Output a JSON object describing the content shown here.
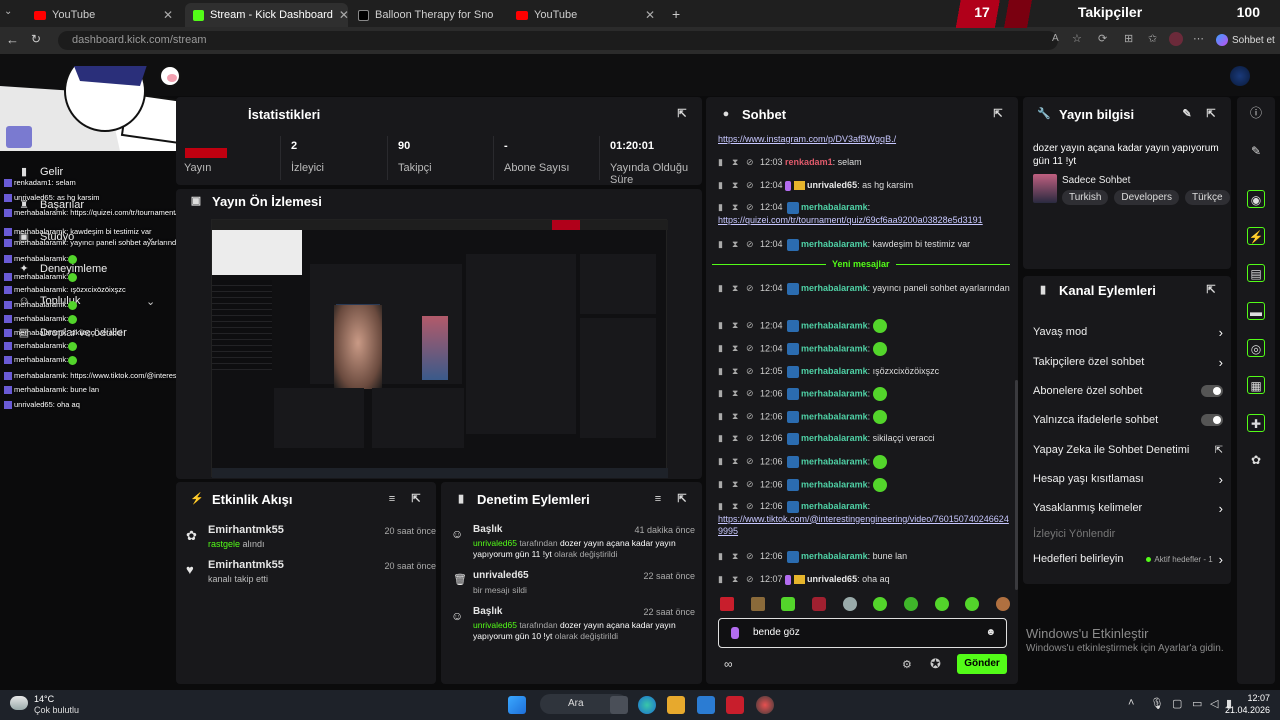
{
  "browser": {
    "tabs": [
      {
        "label": "YouTube",
        "icon": "youtube-icon"
      },
      {
        "label": "Stream - Kick Dashboard",
        "icon": "kick-icon"
      },
      {
        "label": "Balloon Therapy for Snoring & Bre",
        "icon": "tiktok-icon"
      },
      {
        "label": "YouTube",
        "icon": "youtube-icon"
      }
    ],
    "address": "dashboard.kick.com/stream",
    "profile_button": "Sohbet et"
  },
  "overlay": {
    "follower_count": "17",
    "follower_title": "Takipçiler",
    "follower_total": "100",
    "chat_lines": [
      "renkadam1: selam",
      "unrivaled65: as hg karsim",
      "merhabalaramk: https://quizei.com/tr/tournament/quiz/69cf6aa9200a03828e5d3191",
      "merhabalaramk: kawdeşim bi testimiz var",
      "merhabalaramk: yayıncı paneli sohbet ayarlarından",
      "merhabalaramk:",
      "merhabalaramk:",
      "merhabalaramk: ışözxcixözöixşzc",
      "merhabalaramk:",
      "merhabalaramk:",
      "merhabalaramk: sikilaççi veracci",
      "merhabalaramk:",
      "merhabalaramk:",
      "merhabalaramk: https://www.tiktok.com/@interestingengineering/video/7601507402466249995",
      "merhabalaramk: bune lan",
      "unrivaled65: oha aq"
    ]
  },
  "sidebar": {
    "items": [
      {
        "label": "Gelir",
        "icon": "revenue-icon"
      },
      {
        "label": "Başarılar",
        "icon": "trophy-icon"
      },
      {
        "label": "Stüdyo",
        "icon": "studio-icon"
      },
      {
        "label": "Deneyimleme",
        "icon": "experience-icon"
      },
      {
        "label": "Topluluk",
        "icon": "community-icon"
      },
      {
        "label": "Droplar ve ödüller",
        "icon": "drops-icon"
      }
    ]
  },
  "stats": {
    "title": "İstatistikleri",
    "items": [
      {
        "value": "",
        "label": "Yayın"
      },
      {
        "value": "2",
        "label": "İzleyici"
      },
      {
        "value": "90",
        "label": "Takipçi"
      },
      {
        "value": "-",
        "label": "Abone Sayısı"
      },
      {
        "value": "01:20:01",
        "label": "Yayında Olduğu Süre"
      }
    ]
  },
  "preview": {
    "title": "Yayın Ön İzlemesi"
  },
  "activity": {
    "title": "Etkinlik Akışı",
    "items": [
      {
        "user": "Emirhantmk55",
        "action_prefix": "",
        "action": "rastgele",
        "action_suffix": " alındı",
        "time": "20 saat önce"
      },
      {
        "user": "Emirhantmk55",
        "action_prefix": "",
        "action": "",
        "action_suffix": "kanalı takip etti",
        "time": "20 saat önce"
      }
    ]
  },
  "moderation": {
    "title": "Denetim Eylemleri",
    "items": [
      {
        "heading": "Başlık",
        "time": "41 dakika önce",
        "user": "unrivaled65",
        "text1": " tarafından ",
        "value": "dozer yayın açana kadar yayın yapıyorum gün 11 !yt",
        "text2": " olarak değiştirildi"
      },
      {
        "heading": "unrivaled65",
        "time": "22 saat önce",
        "user": "",
        "text1": "bir mesajı sildi",
        "value": "",
        "text2": ""
      },
      {
        "heading": "Başlık",
        "time": "22 saat önce",
        "user": "unrivaled65",
        "text1": " tarafından ",
        "value": "dozer yayın açana kadar yayın yapıyorum gün 10 !yt",
        "text2": " olarak değiştirildi"
      }
    ]
  },
  "chat": {
    "title": "Sohbet",
    "top_link": "https://www.instagram.com/p/DV3afBWgqB./",
    "new_messages": "Yeni mesajlar",
    "messages": [
      {
        "time": "12:03",
        "user": "renkadam1",
        "color": "#e05a6b",
        "text": "selam",
        "kind": "text"
      },
      {
        "time": "12:04",
        "user": "unrivaled65",
        "color": "#e8e8e8",
        "text": "as hg karsim",
        "kind": "text"
      },
      {
        "time": "12:04",
        "user": "merhabalaramk",
        "color": "#4fd0a5",
        "text": "https://quizei.com/tr/tournament/quiz/69cf6aa9200a03828e5d3191",
        "kind": "link"
      },
      {
        "time": "12:04",
        "user": "merhabalaramk",
        "color": "#4fd0a5",
        "text": "kawdeşim bi testimiz var",
        "kind": "text"
      },
      {
        "time": "12:04",
        "user": "merhabalaramk",
        "color": "#4fd0a5",
        "text": "yayıncı paneli sohbet ayarlarından",
        "kind": "text"
      },
      {
        "time": "12:04",
        "user": "merhabalaramk",
        "color": "#4fd0a5",
        "text": "",
        "kind": "emote"
      },
      {
        "time": "12:04",
        "user": "merhabalaramk",
        "color": "#4fd0a5",
        "text": "",
        "kind": "emote"
      },
      {
        "time": "12:05",
        "user": "merhabalaramk",
        "color": "#4fd0a5",
        "text": "ışözxcixözöixşzc",
        "kind": "text"
      },
      {
        "time": "12:06",
        "user": "merhabalaramk",
        "color": "#4fd0a5",
        "text": "",
        "kind": "emote"
      },
      {
        "time": "12:06",
        "user": "merhabalaramk",
        "color": "#4fd0a5",
        "text": "",
        "kind": "emote"
      },
      {
        "time": "12:06",
        "user": "merhabalaramk",
        "color": "#4fd0a5",
        "text": "sikilaççi veracci",
        "kind": "text"
      },
      {
        "time": "12:06",
        "user": "merhabalaramk",
        "color": "#4fd0a5",
        "text": "",
        "kind": "emote"
      },
      {
        "time": "12:06",
        "user": "merhabalaramk",
        "color": "#4fd0a5",
        "text": "",
        "kind": "emote"
      },
      {
        "time": "12:06",
        "user": "merhabalaramk",
        "color": "#4fd0a5",
        "text": "https://www.tiktok.com/@interestingengineering/video/7601507402466249995",
        "kind": "link"
      },
      {
        "time": "12:06",
        "user": "merhabalaramk",
        "color": "#4fd0a5",
        "text": "bune lan",
        "kind": "text"
      },
      {
        "time": "12:07",
        "user": "unrivaled65",
        "color": "#e8e8e8",
        "text": "oha aq",
        "kind": "text"
      }
    ],
    "input_value": "bende göz",
    "send_label": "Gönder"
  },
  "stream_info": {
    "title": "Yayın bilgisi",
    "stream_title": "dozer yayın açana kadar yayın yapıyorum gün 11 !yt",
    "category": "Sadece Sohbet",
    "tags": [
      "Turkish",
      "Developers",
      "Türkçe"
    ]
  },
  "channel_actions": {
    "title": "Kanal Eylemleri",
    "rows": [
      {
        "label": "Yavaş mod",
        "control": "arrow"
      },
      {
        "label": "Takipçilere özel sohbet",
        "control": "arrow"
      },
      {
        "label": "Abonelere özel sohbet",
        "control": "toggle"
      },
      {
        "label": "Yalnızca ifadelerle sohbet",
        "control": "toggle"
      },
      {
        "label": "Yapay Zeka ile Sohbet Denetimi",
        "control": "external"
      },
      {
        "label": "Hesap yaşı kısıtlaması",
        "control": "arrow"
      },
      {
        "label": "Yasaklanmış kelimeler",
        "control": "arrow"
      },
      {
        "label": "İzleyici Yönlendir",
        "control": "none"
      },
      {
        "label": "Hedefleri belirleyin",
        "control": "arrow"
      }
    ],
    "goals_status": "Aktif hedefler - 1"
  },
  "windows": {
    "activate_title": "Windows'u Etkinleştir",
    "activate_sub": "Windows'u etkinleştirmek için Ayarlar'a gidin.",
    "weather_temp": "14°C",
    "weather_desc": "Çok bulutlu",
    "search_label": "Ara",
    "time": "12:07",
    "date": "21.04.2026"
  },
  "colors": {
    "kick_green": "#53fc18",
    "bg": "#0b0b0c",
    "card": "#18181b"
  }
}
